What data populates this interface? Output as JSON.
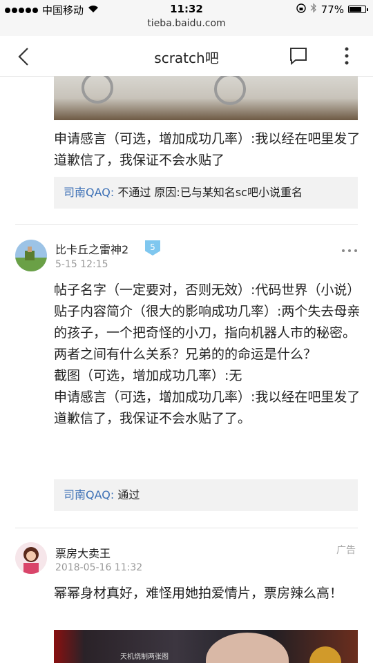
{
  "status": {
    "carrier": "中国移动",
    "time": "11:32",
    "battery": "77%",
    "battery_level": 0.77,
    "url": "tieba.baidu.com"
  },
  "nav": {
    "title": "scratch吧"
  },
  "post1": {
    "tail_text": "申请感言（可选，增加成功几率）:我以经在吧里发了道歉信了，我保证不会水贴了",
    "reply_user": "司南QAQ:",
    "reply_text": " 不通过 原因:已与某知名sc吧小说重名"
  },
  "post2": {
    "username": "比卡丘之雷神2",
    "level": "5",
    "time": "5-15 12:15",
    "lines": [
      "帖子名字（一定要对，否则无效）:代码世界（小说）",
      "贴子内容简介（很大的影响成功几率）:两个失去母亲的孩子，一个把奇怪的小刀，指向机器人市的秘密。两者之间有什么关系？兄弟的的命运是什么？",
      "截图（可选，增加成功几率）:无",
      "申请感言（可选，增加成功几率）:我以经在吧里发了道歉信了，我保证不会水贴了了。"
    ],
    "reply_user": "司南QAQ:",
    "reply_text": " 通过"
  },
  "post3": {
    "username": "票房大卖王",
    "ad_label": "广告",
    "time": "2018-05-16 11:32",
    "text": "幂幂身材真好，难怪用她拍爱情片，票房辣么高！",
    "image_caption": "天机烧制两张图"
  },
  "icons": {
    "back": "chevron-left-icon",
    "comment": "comment-icon",
    "more": "more-vertical-icon"
  }
}
